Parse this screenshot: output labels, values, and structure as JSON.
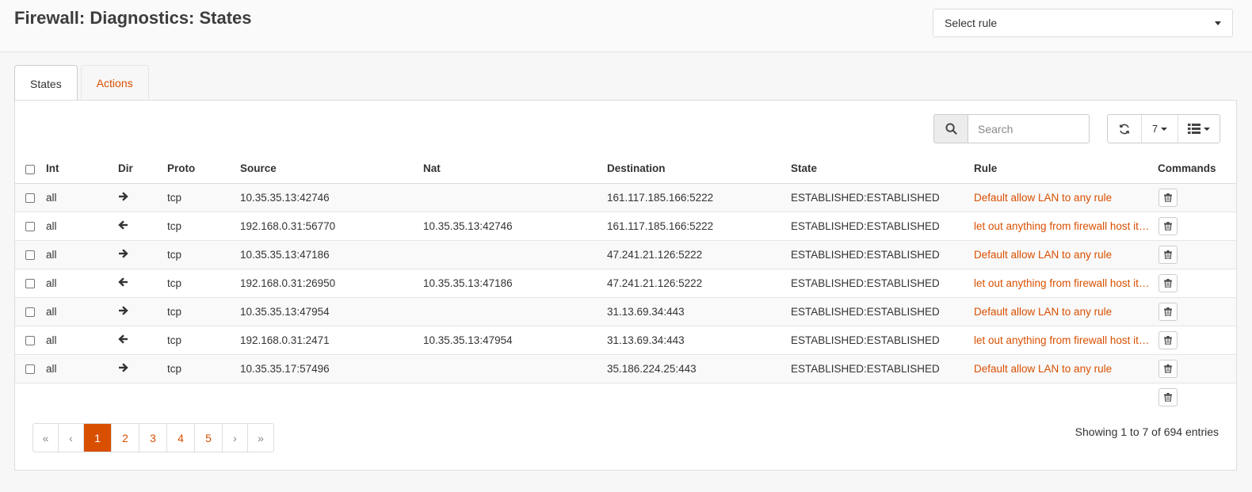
{
  "header": {
    "title": "Firewall: Diagnostics: States",
    "rule_select": "Select rule"
  },
  "tabs": [
    {
      "label": "States",
      "active": true
    },
    {
      "label": "Actions",
      "active": false
    }
  ],
  "toolbar": {
    "search_placeholder": "Search",
    "row_count": "7"
  },
  "table": {
    "columns": [
      "Int",
      "Dir",
      "Proto",
      "Source",
      "Nat",
      "Destination",
      "State",
      "Rule",
      "Commands"
    ],
    "rows": [
      {
        "int": "all",
        "dir": "out",
        "proto": "tcp",
        "source": "10.35.35.13:42746",
        "nat": "",
        "destination": "161.117.185.166:5222",
        "state": "ESTABLISHED:ESTABLISHED",
        "rule": "Default allow LAN to any rule"
      },
      {
        "int": "all",
        "dir": "in",
        "proto": "tcp",
        "source": "192.168.0.31:56770",
        "nat": "10.35.35.13:42746",
        "destination": "161.117.185.166:5222",
        "state": "ESTABLISHED:ESTABLISHED",
        "rule": "let out anything from firewall host itself"
      },
      {
        "int": "all",
        "dir": "out",
        "proto": "tcp",
        "source": "10.35.35.13:47186",
        "nat": "",
        "destination": "47.241.21.126:5222",
        "state": "ESTABLISHED:ESTABLISHED",
        "rule": "Default allow LAN to any rule"
      },
      {
        "int": "all",
        "dir": "in",
        "proto": "tcp",
        "source": "192.168.0.31:26950",
        "nat": "10.35.35.13:47186",
        "destination": "47.241.21.126:5222",
        "state": "ESTABLISHED:ESTABLISHED",
        "rule": "let out anything from firewall host itself"
      },
      {
        "int": "all",
        "dir": "out",
        "proto": "tcp",
        "source": "10.35.35.13:47954",
        "nat": "",
        "destination": "31.13.69.34:443",
        "state": "ESTABLISHED:ESTABLISHED",
        "rule": "Default allow LAN to any rule"
      },
      {
        "int": "all",
        "dir": "in",
        "proto": "tcp",
        "source": "192.168.0.31:2471",
        "nat": "10.35.35.13:47954",
        "destination": "31.13.69.34:443",
        "state": "ESTABLISHED:ESTABLISHED",
        "rule": "let out anything from firewall host itself"
      },
      {
        "int": "all",
        "dir": "out",
        "proto": "tcp",
        "source": "10.35.35.17:57496",
        "nat": "",
        "destination": "35.186.224.25:443",
        "state": "ESTABLISHED:ESTABLISHED",
        "rule": "Default allow LAN to any rule"
      }
    ]
  },
  "pagination": {
    "first": "«",
    "prev": "‹",
    "pages": [
      "1",
      "2",
      "3",
      "4",
      "5"
    ],
    "active_page": "1",
    "next": "›",
    "last": "»"
  },
  "info": "Showing 1 to 7 of 694 entries",
  "icons": {
    "search": "search-icon",
    "refresh": "refresh-icon",
    "columns": "list-icon",
    "delete": "trash-icon",
    "out": "arrow-right-icon",
    "in": "arrow-left-icon"
  },
  "colors": {
    "accent": "#d94f00"
  }
}
